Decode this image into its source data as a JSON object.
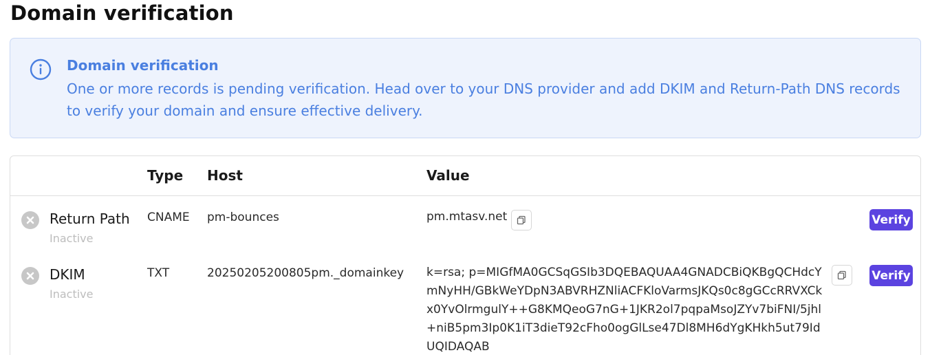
{
  "page": {
    "title": "Domain verification"
  },
  "alert": {
    "icon": "info-icon",
    "title": "Domain verification",
    "body": "One or more records is pending verification. Head over to your DNS provider and add DKIM and Return-Path DNS records to verify your domain and ensure effective delivery.",
    "color": "#4a7fe0",
    "background": "#eef3fd"
  },
  "table": {
    "headers": {
      "type": "Type",
      "host": "Host",
      "value": "Value"
    },
    "rows": [
      {
        "name": "Return Path",
        "status": "Inactive",
        "status_icon": "x-circle-icon",
        "type": "CNAME",
        "host": "pm-bounces",
        "value": "pm.mtasv.net",
        "verify_label": "Verify"
      },
      {
        "name": "DKIM",
        "status": "Inactive",
        "status_icon": "x-circle-icon",
        "type": "TXT",
        "host": "20250205200805pm._domainkey",
        "value": "k=rsa; p=MIGfMA0GCSqGSIb3DQEBAQUAA4GNADCBiQKBgQCHdcYmNyHH/GBkWeYDpN3ABVRHZNliACFKloVarmsJKQs0c8gGCcRRVXCkx0YvOlrmgulY++G8KMQeoG7nG+1JKR2ol7pqpaMsoJZYv7biFNI/5jhl+niB5pm3Ip0K1iT3dieT92cFho0ogGlLse47Dl8MH6dYgKHkh5ut79IdUQIDAQAB",
        "verify_label": "Verify"
      }
    ]
  },
  "colors": {
    "verify_button": "#5b43e0",
    "inactive_icon": "#c7c7c7",
    "inactive_text": "#bdbdbd"
  }
}
